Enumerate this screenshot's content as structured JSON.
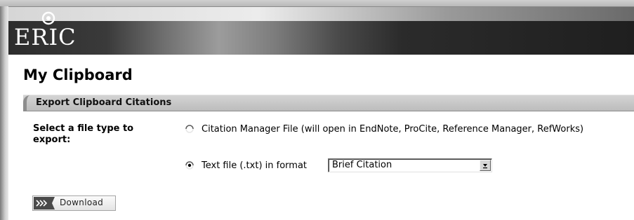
{
  "header": {
    "logo_text": "ERIC"
  },
  "page": {
    "title": "My Clipboard"
  },
  "section": {
    "title": "Export Clipboard Citations"
  },
  "form": {
    "file_type_label": "Select a file type to export:",
    "options": [
      {
        "label": "Citation Manager File (will open in EndNote, ProCite, Reference Manager, RefWorks)",
        "selected": false
      },
      {
        "label": "Text file (.txt) in format",
        "selected": true
      }
    ],
    "format_select": {
      "value": "Brief Citation"
    },
    "download_label": "Download"
  },
  "colors": {
    "section_bar": "#c8c8c8",
    "banner_dark": "#2b2b2b"
  }
}
